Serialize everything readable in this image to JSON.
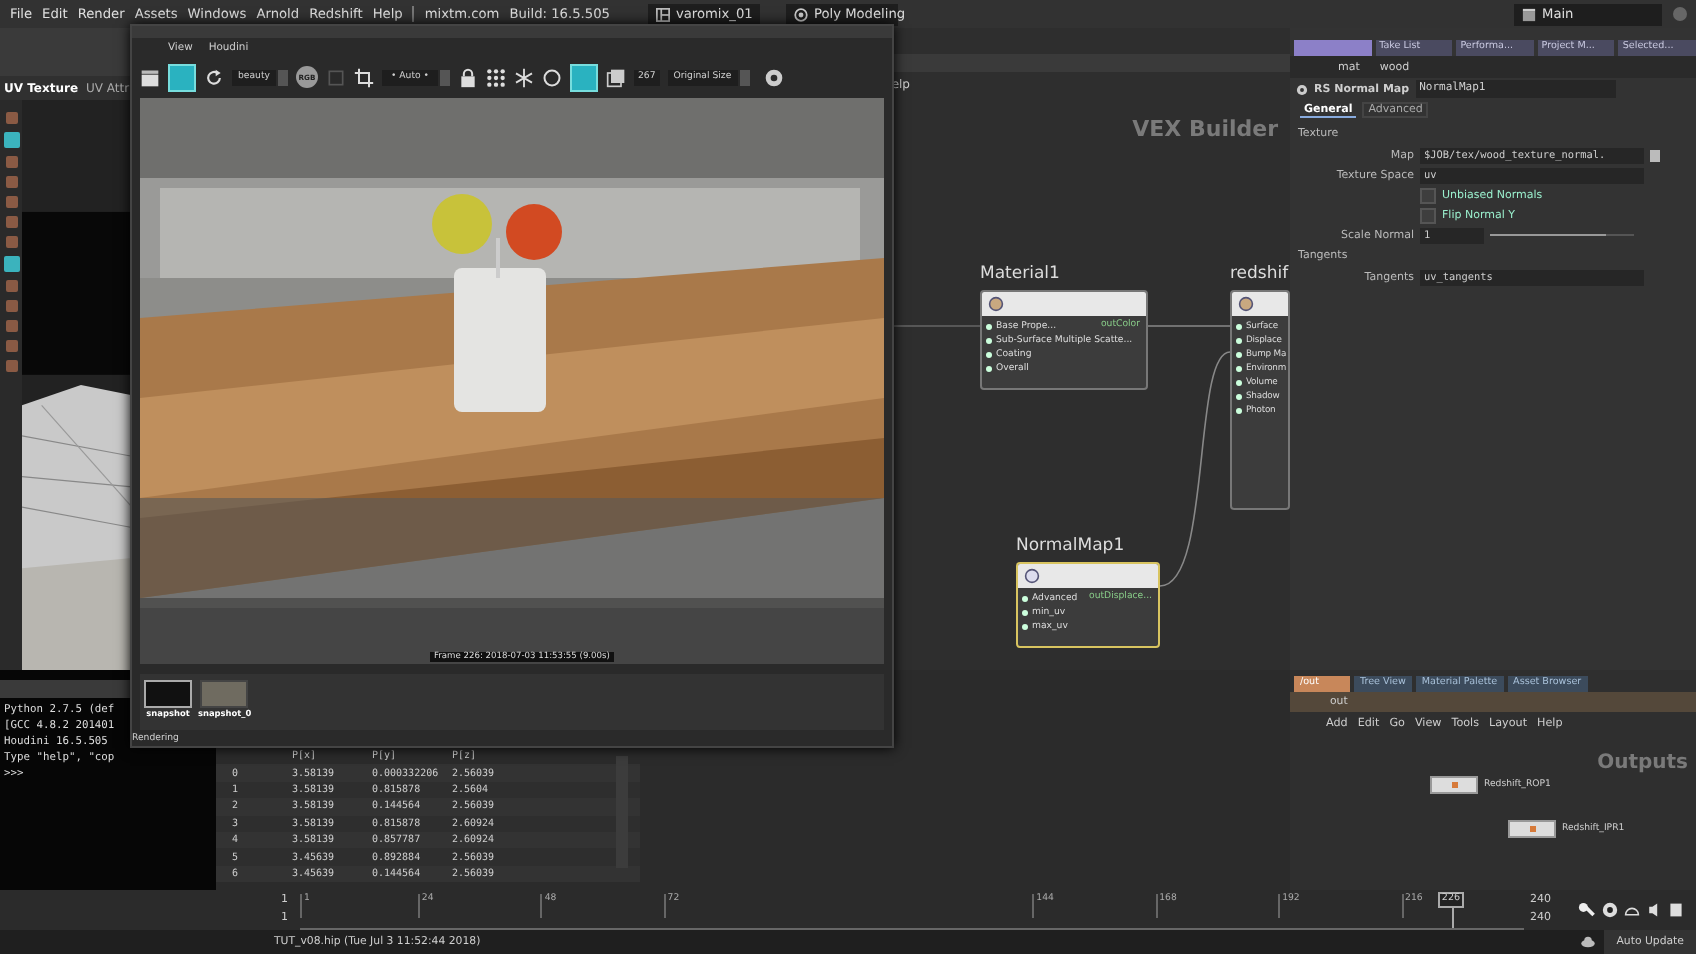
{
  "menubar": {
    "menus": [
      "File",
      "Edit",
      "Render",
      "Assets",
      "Windows",
      "Arnold",
      "Redshift",
      "Help"
    ],
    "site": "mixtm.com",
    "build": "Build: 16.5.505",
    "desktop": "varomix_01",
    "shelf_set": "Poly Modeling",
    "workspace": "Main"
  },
  "scene_viewer": {
    "tabs": [
      {
        "label": "UV Texture",
        "selected": true
      },
      {
        "label": "UV Attr",
        "selected": false
      }
    ]
  },
  "network_editor": {
    "menu_fragment": "elp",
    "context": "VEX Builder",
    "nodes": [
      {
        "name": "Material1",
        "kind": "material",
        "selected": false,
        "inputs": [
          "Base Prope...",
          "Sub-Surface Multiple Scatte...",
          "Coating",
          "Overall"
        ],
        "output": "outColor"
      },
      {
        "name": "redshif",
        "kind": "output",
        "selected": false,
        "inputs": [
          "Surface",
          "Displace",
          "Bump Ma",
          "Environm",
          "Volume",
          "Shadow",
          "Photon"
        ]
      },
      {
        "name": "NormalMap1",
        "kind": "normal_map",
        "selected": true,
        "inputs": [
          "Advanced",
          "min_uv",
          "max_uv"
        ],
        "output": "outDisplace..."
      }
    ]
  },
  "parameter_pane": {
    "tabs": [
      {
        "selected": true
      },
      {
        "label": "Take List",
        "selected": false
      },
      {
        "label": "Performa...",
        "selected": false
      },
      {
        "label": "Project M...",
        "selected": false
      },
      {
        "label": "Selected...",
        "selected": false
      }
    ],
    "path": [
      "mat",
      "wood"
    ],
    "node_type": "RS Normal Map",
    "node_name": "NormalMap1",
    "parm_tabs": [
      {
        "label": "General",
        "selected": true
      },
      {
        "label": "Advanced",
        "selected": false
      }
    ],
    "parameters": [
      {
        "kind": "heading",
        "label": "Texture"
      },
      {
        "kind": "file",
        "label": "Map",
        "value": "$JOB/tex/wood_texture_normal."
      },
      {
        "kind": "text",
        "label": "Texture Space",
        "value": "uv"
      },
      {
        "kind": "toggle",
        "label": "Unbiased Normals",
        "checked": false
      },
      {
        "kind": "toggle",
        "label": "Flip Normal Y",
        "checked": false
      },
      {
        "kind": "slider",
        "label": "Scale Normal",
        "value": "1",
        "level": 0.8
      },
      {
        "kind": "heading",
        "label": "Tangents"
      },
      {
        "kind": "text",
        "label": "Tangents",
        "value": "uv_tangents"
      }
    ]
  },
  "render_view": {
    "menus": [
      "View",
      "Houdini"
    ],
    "aov": "beauty",
    "channel": "RGB",
    "zoom_mode": "• Auto •",
    "size_value": "267",
    "size": "Original Size",
    "caption": "Frame 226: 2018-07-03 11:53:55 (9.00s)",
    "snapshots": [
      {
        "label": "snapshot",
        "selected": true
      },
      {
        "label": "snapshot_0",
        "selected": false
      }
    ],
    "status": "Rendering"
  },
  "python_shell": {
    "lines": [
      "Python 2.7.5 (def",
      "[GCC 4.8.2 201401",
      "Houdini 16.5.505",
      "Type \"help\", \"cop",
      ">>>"
    ]
  },
  "spreadsheet": {
    "columns": [
      "",
      "P[x]",
      "P[y]",
      "P[z]"
    ],
    "rows": [
      [
        "0",
        "3.58139",
        "0.000332206",
        "2.56039"
      ],
      [
        "1",
        "3.58139",
        "0.815878",
        "2.5604"
      ],
      [
        "2",
        "3.58139",
        "0.144564",
        "2.56039"
      ],
      [
        "3",
        "3.58139",
        "0.815878",
        "2.60924"
      ],
      [
        "4",
        "3.58139",
        "0.857787",
        "2.60924"
      ],
      [
        "5",
        "3.45639",
        "0.892884",
        "2.56039"
      ],
      [
        "6",
        "3.45639",
        "0.144564",
        "2.56039"
      ]
    ]
  },
  "output_network": {
    "tabs": [
      {
        "label": "/out",
        "selected": true
      },
      {
        "label": "Tree View",
        "selected": false
      },
      {
        "label": "Material Palette",
        "selected": false
      },
      {
        "label": "Asset Browser",
        "selected": false
      }
    ],
    "path": "out",
    "menus": [
      "Add",
      "Edit",
      "Go",
      "View",
      "Tools",
      "Layout",
      "Help"
    ],
    "context": "Outputs",
    "nodes": [
      {
        "name": "Redshift_ROP1"
      },
      {
        "name": "Redshift_IPR1"
      }
    ]
  },
  "timeline": {
    "start": "1",
    "range_start": "1",
    "ticks": [
      "1",
      "24",
      "48",
      "72",
      "144",
      "168",
      "192",
      "216"
    ],
    "current": "226",
    "end": "240",
    "range_end": "240",
    "level": 0.941
  },
  "status_bar": {
    "file": "TUT_v08.hip (Tue Jul 3 11:52:44 2018)",
    "update_mode": "Auto Update"
  }
}
